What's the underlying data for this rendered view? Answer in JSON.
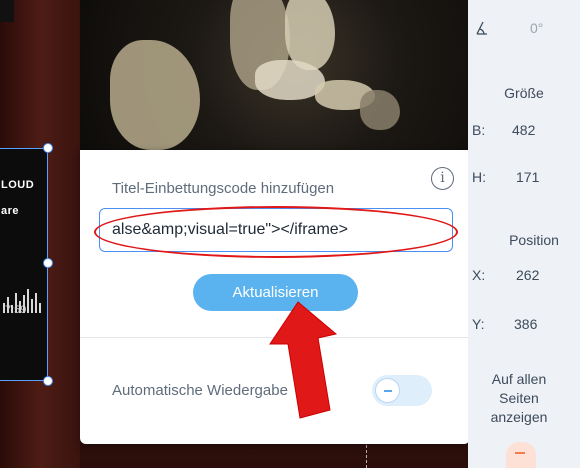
{
  "widget": {
    "line1": "LOUD",
    "line2": "are",
    "time": "7:59"
  },
  "panel": {
    "embed_label": "Titel-Einbettungscode hinzufügen",
    "embed_value": "alse&amp;visual=true\"></iframe>",
    "update_button": "Aktualisieren",
    "autoplay_label": "Automatische Wiedergabe",
    "info_icon": "i"
  },
  "properties": {
    "rotation_value": "0°",
    "size_heading": "Größe",
    "width_label": "B:",
    "width_value": "482",
    "height_label": "H:",
    "height_value": "171",
    "position_heading": "Position",
    "x_label": "X:",
    "x_value": "262",
    "y_label": "Y:",
    "y_value": "386",
    "show_all_pages": "Auf allen Seiten anzeigen"
  },
  "colors": {
    "accent": "#4a8ff2",
    "button": "#5ab2ee",
    "annotation": "#e01818"
  }
}
